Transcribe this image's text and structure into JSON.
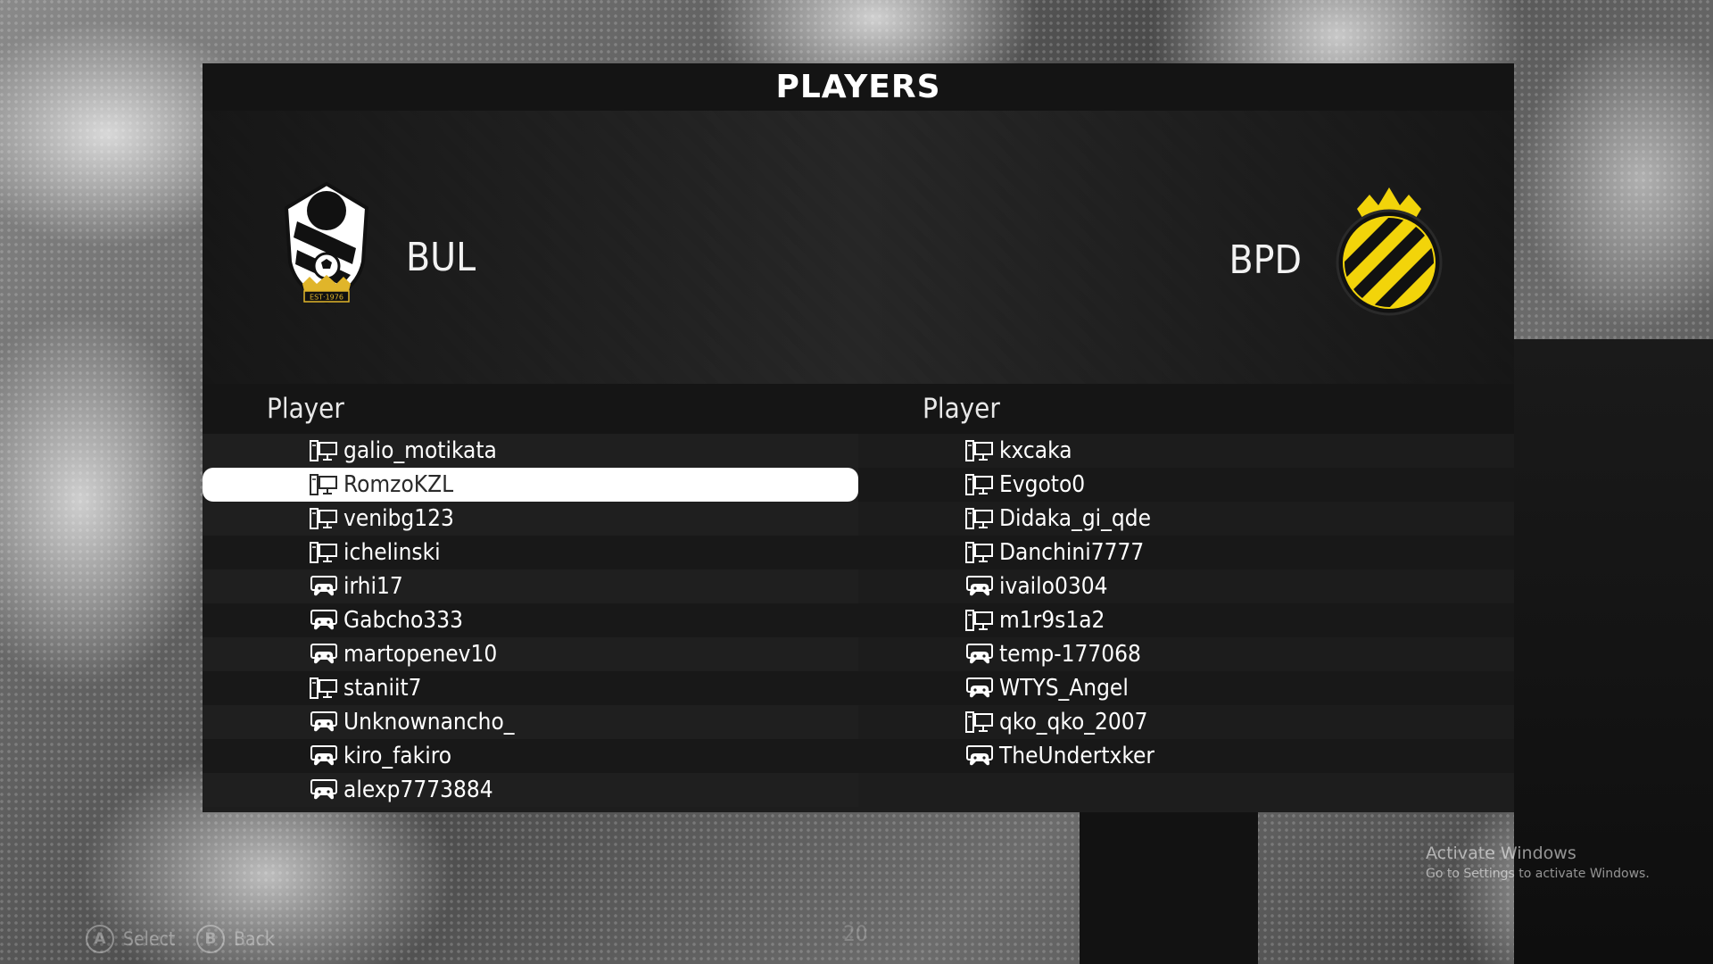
{
  "header": {
    "title": "PLAYERS"
  },
  "teams": {
    "home": {
      "abbr": "BUL",
      "crest_icon": "bear-shield-crest-icon",
      "crest_text": "EST·1976"
    },
    "away": {
      "abbr": "BPD",
      "crest_icon": "crowned-striped-badge-icon"
    }
  },
  "columns": {
    "home_header": "Player",
    "away_header": "Player"
  },
  "home_players": [
    {
      "name": "galio_motikata",
      "platform": "pc"
    },
    {
      "name": "RomzoKZL",
      "platform": "pc",
      "selected": true
    },
    {
      "name": "venibg123",
      "platform": "pc"
    },
    {
      "name": "ichelinski",
      "platform": "pc"
    },
    {
      "name": "irhi17",
      "platform": "console"
    },
    {
      "name": "Gabcho333",
      "platform": "console"
    },
    {
      "name": "martopenev10",
      "platform": "console"
    },
    {
      "name": "staniit7",
      "platform": "pc"
    },
    {
      "name": "Unknownancho_",
      "platform": "console"
    },
    {
      "name": "kiro_fakiro",
      "platform": "console"
    },
    {
      "name": "alexp7773884",
      "platform": "console"
    }
  ],
  "away_players": [
    {
      "name": "kxcaka",
      "platform": "pc"
    },
    {
      "name": "Evgoto0",
      "platform": "pc"
    },
    {
      "name": "Didaka_gi_qde",
      "platform": "pc"
    },
    {
      "name": "Danchini7777",
      "platform": "pc"
    },
    {
      "name": "ivailo0304",
      "platform": "console"
    },
    {
      "name": "m1r9s1a2",
      "platform": "pc"
    },
    {
      "name": "temp-177068",
      "platform": "console"
    },
    {
      "name": "WTYS_Angel",
      "platform": "console"
    },
    {
      "name": "qko_qko_2007",
      "platform": "pc"
    },
    {
      "name": "TheUndertxker",
      "platform": "console"
    }
  ],
  "footer": {
    "select": {
      "button": "A",
      "label": "Select"
    },
    "back": {
      "button": "B",
      "label": "Back"
    },
    "page": "20"
  },
  "watermark": {
    "title": "Activate Windows",
    "subtitle": "Go to Settings to activate Windows."
  },
  "colors": {
    "panel": "#1b1b1b",
    "selected_row": "#ffffff",
    "away_badge_yellow": "#f2d40a"
  }
}
